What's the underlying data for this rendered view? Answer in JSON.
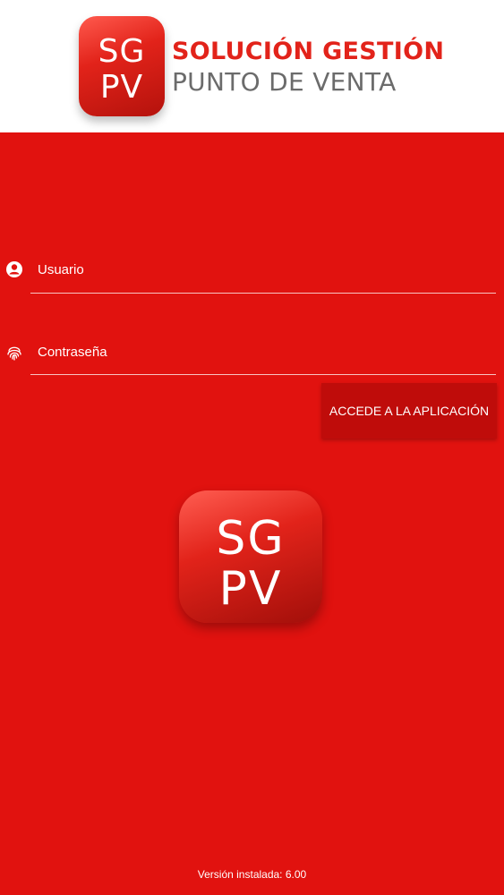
{
  "header": {
    "logo_line1": "SG",
    "logo_line2": "PV",
    "brand_line1": "SOLUCIÓN GESTIÓN",
    "brand_line2": "PUNTO DE VENTA"
  },
  "login": {
    "user_field": {
      "placeholder": "Usuario",
      "icon": "user-icon"
    },
    "password_field": {
      "placeholder": "Contraseña",
      "icon": "fingerprint-icon"
    },
    "submit_label": "ACCEDE A LA APLICACIÓN"
  },
  "center_logo": {
    "line1": "SG",
    "line2": "PV"
  },
  "footer": {
    "version_text": "Versión instalada: 6.00"
  },
  "colors": {
    "brand_red": "#e1120f",
    "button_red": "#bf0c0a",
    "brand_gray": "#6b6b6b"
  }
}
